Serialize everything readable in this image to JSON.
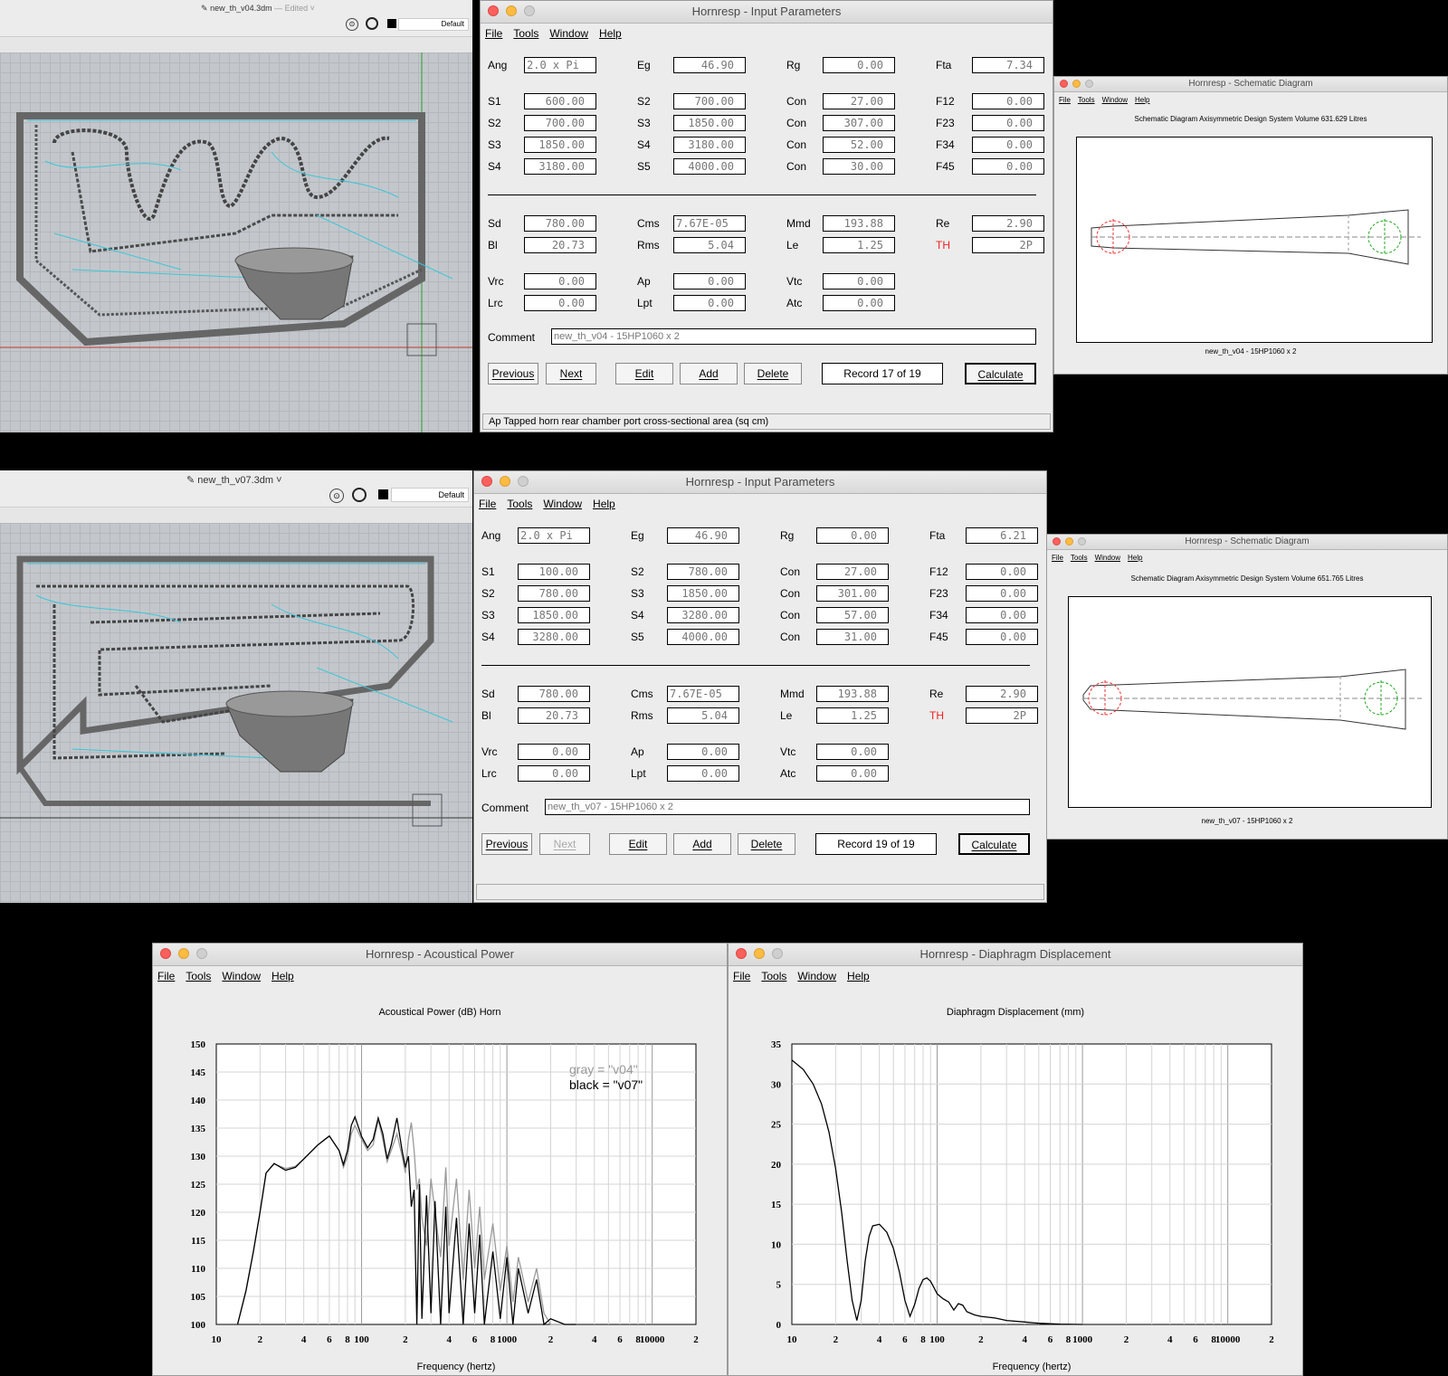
{
  "cad": [
    {
      "file": "new_th_v04.3dm",
      "edited": "— Edited ˅",
      "layer": "Default"
    },
    {
      "file": "new_th_v07.3dm ˅",
      "edited": "",
      "layer": "Default"
    }
  ],
  "menus": [
    "File",
    "Tools",
    "Window",
    "Help"
  ],
  "input_windows": [
    {
      "title": "Hornresp - Input Parameters",
      "fields": {
        "ang": "2.0 x Pi",
        "eg": "46.90",
        "rg": "0.00",
        "fta": "7.34",
        "s1": "600.00",
        "s2b": "700.00",
        "con1": "27.00",
        "f12": "0.00",
        "s2": "700.00",
        "s3b": "1850.00",
        "con2": "307.00",
        "f23": "0.00",
        "s3": "1850.00",
        "s4b": "3180.00",
        "con3": "52.00",
        "f34": "0.00",
        "s4": "3180.00",
        "s5": "4000.00",
        "con4": "30.00",
        "f45": "0.00",
        "sd": "780.00",
        "cms": "7.67E-05",
        "mmd": "193.88",
        "re": "2.90",
        "bl": "20.73",
        "rms": "5.04",
        "le": "1.25",
        "th": "2P",
        "vrc": "0.00",
        "ap": "0.00",
        "vtc": "0.00",
        "lrc": "0.00",
        "lpt": "0.00",
        "atc": "0.00",
        "comment": "new_th_v04 - 15HP1060 x 2"
      },
      "record": "Record 17 of 19",
      "next_disabled": false,
      "status": "Ap    Tapped horn rear chamber port cross-sectional area  (sq cm)"
    },
    {
      "title": "Hornresp - Input Parameters",
      "fields": {
        "ang": "2.0 x Pi",
        "eg": "46.90",
        "rg": "0.00",
        "fta": "6.21",
        "s1": "100.00",
        "s2b": "780.00",
        "con1": "27.00",
        "f12": "0.00",
        "s2": "780.00",
        "s3b": "1850.00",
        "con2": "301.00",
        "f23": "0.00",
        "s3": "1850.00",
        "s4b": "3280.00",
        "con3": "57.00",
        "f34": "0.00",
        "s4": "3280.00",
        "s5": "4000.00",
        "con4": "31.00",
        "f45": "0.00",
        "sd": "780.00",
        "cms": "7.67E-05",
        "mmd": "193.88",
        "re": "2.90",
        "bl": "20.73",
        "rms": "5.04",
        "le": "1.25",
        "th": "2P",
        "vrc": "0.00",
        "ap": "0.00",
        "vtc": "0.00",
        "lrc": "0.00",
        "lpt": "0.00",
        "atc": "0.00",
        "comment": "new_th_v07 - 15HP1060 x 2"
      },
      "record": "Record 19 of 19",
      "next_disabled": true,
      "status": ""
    }
  ],
  "labels": {
    "ang": "Ang",
    "eg": "Eg",
    "rg": "Rg",
    "fta": "Fta",
    "s1": "S1",
    "s2": "S2",
    "s3": "S3",
    "s4": "S4",
    "s5": "S5",
    "con": "Con",
    "f12": "F12",
    "f23": "F23",
    "f34": "F34",
    "f45": "F45",
    "sd": "Sd",
    "cms": "Cms",
    "mmd": "Mmd",
    "re": "Re",
    "bl": "Bl",
    "rms": "Rms",
    "le": "Le",
    "th": "TH",
    "vrc": "Vrc",
    "ap": "Ap",
    "vtc": "Vtc",
    "lrc": "Lrc",
    "lpt": "Lpt",
    "atc": "Atc",
    "comment": "Comment"
  },
  "buttons": {
    "previous": "Previous",
    "next": "Next",
    "edit": "Edit",
    "add": "Add",
    "delete": "Delete",
    "calculate": "Calculate"
  },
  "schematics": [
    {
      "title": "Hornresp - Schematic Diagram",
      "header": "Schematic Diagram   Axisymmetric Design   System Volume 631.629 Litres",
      "caption": "new_th_v04 - 15HP1060 x 2"
    },
    {
      "title": "Hornresp - Schematic Diagram",
      "header": "Schematic Diagram   Axisymmetric Design   System Volume 651.765 Litres",
      "caption": "new_th_v07 - 15HP1060 x 2"
    }
  ],
  "chart_windows": [
    {
      "title": "Hornresp - Acoustical Power"
    },
    {
      "title": "Hornresp - Diaphragm Displacement"
    }
  ],
  "chart_data": [
    {
      "type": "line",
      "title": "Acoustical Power (dB)   Horn",
      "xlabel": "Frequency (hertz)",
      "ylabel": "",
      "xscale": "log",
      "xlim": [
        10,
        20000
      ],
      "ylim": [
        100,
        150
      ],
      "x_tick_labels": [
        "10",
        "2",
        "4",
        "6",
        "8",
        "100",
        "2",
        "4",
        "6",
        "8",
        "1000",
        "2",
        "4",
        "6",
        "8",
        "10000",
        "2"
      ],
      "y_tick_labels": [
        "150",
        "145",
        "140",
        "135",
        "130",
        "125",
        "120",
        "115",
        "110",
        "105",
        "100"
      ],
      "annotations": [
        "gray = \"v04\"",
        "black = \"v07\""
      ],
      "grid": true,
      "series": [
        {
          "name": "v04",
          "color": "#9a9a9a",
          "x": [
            14,
            16,
            18,
            20,
            22,
            25,
            30,
            35,
            40,
            50,
            60,
            70,
            75,
            80,
            85,
            90,
            100,
            110,
            120,
            130,
            140,
            150,
            160,
            175,
            190,
            200,
            210,
            220,
            230,
            240,
            250,
            260,
            280,
            300,
            320,
            350,
            380,
            400,
            450,
            500,
            550,
            600,
            650,
            700,
            800,
            900,
            1000,
            1100,
            1200,
            1400,
            1600,
            1800,
            2000,
            2500,
            3000
          ],
          "y": [
            100,
            106,
            113,
            120,
            127,
            128.6,
            127.8,
            128.2,
            129.5,
            132,
            133.6,
            131,
            128,
            130,
            134,
            135.5,
            133,
            131,
            132,
            136.5,
            133,
            129,
            131,
            134,
            130,
            127,
            133,
            136,
            131,
            124,
            126,
            119,
            114,
            126,
            120,
            112,
            128,
            114,
            126,
            108,
            124,
            110,
            121,
            108,
            118,
            106,
            114,
            104,
            112,
            104,
            110,
            102,
            100,
            100,
            100
          ]
        },
        {
          "name": "v07",
          "color": "#000000",
          "x": [
            14,
            16,
            18,
            20,
            22,
            25,
            30,
            35,
            40,
            50,
            60,
            70,
            75,
            80,
            85,
            90,
            100,
            110,
            120,
            130,
            140,
            150,
            160,
            175,
            190,
            200,
            210,
            220,
            230,
            240,
            250,
            260,
            280,
            300,
            320,
            350,
            380,
            400,
            450,
            500,
            550,
            600,
            650,
            700,
            800,
            900,
            1000,
            1100,
            1200,
            1400,
            1600,
            1800,
            2000,
            2500,
            3000
          ],
          "y": [
            100,
            106,
            113,
            120,
            127,
            128.7,
            127.5,
            128,
            129.5,
            132,
            133.6,
            131,
            128.5,
            131,
            135.5,
            137,
            133.5,
            131.5,
            133,
            136.8,
            134,
            129.5,
            132,
            136.8,
            131,
            128,
            130,
            121,
            124,
            100,
            125,
            101,
            123,
            102,
            122,
            100,
            121,
            102,
            119,
            100,
            118,
            102,
            116,
            100,
            113,
            101,
            112,
            100,
            110,
            102,
            108,
            100,
            101,
            100,
            100
          ]
        }
      ]
    },
    {
      "type": "line",
      "title": "Diaphragm Displacement (mm)",
      "xlabel": "Frequency (hertz)",
      "ylabel": "",
      "xscale": "log",
      "xlim": [
        10,
        20000
      ],
      "ylim": [
        0,
        35
      ],
      "x_tick_labels": [
        "10",
        "2",
        "4",
        "6",
        "8",
        "100",
        "2",
        "4",
        "6",
        "8",
        "1000",
        "2",
        "4",
        "6",
        "8",
        "10000",
        "2"
      ],
      "y_tick_labels": [
        "35",
        "30",
        "25",
        "20",
        "15",
        "10",
        "5",
        "0"
      ],
      "grid": true,
      "series": [
        {
          "name": "",
          "color": "#000000",
          "x": [
            10,
            12,
            14,
            16,
            18,
            20,
            22,
            24,
            26,
            28,
            30,
            32,
            34,
            36,
            40,
            45,
            50,
            55,
            60,
            65,
            70,
            75,
            80,
            85,
            90,
            95,
            100,
            110,
            120,
            130,
            140,
            150,
            160,
            180,
            200,
            250,
            300,
            400,
            500,
            700,
            1000
          ],
          "y": [
            33,
            31.8,
            30,
            27.5,
            24,
            19.5,
            14,
            8,
            3,
            0.5,
            3,
            8,
            11,
            12.3,
            12.5,
            11.5,
            9.5,
            6.5,
            3,
            1,
            2.5,
            4.5,
            5.6,
            5.8,
            5.4,
            4.6,
            3.8,
            3.2,
            2.8,
            1.8,
            2.6,
            2.4,
            1.6,
            1.2,
            1.0,
            0.8,
            0.5,
            0.3,
            0.15,
            0.05,
            0
          ]
        }
      ]
    }
  ]
}
